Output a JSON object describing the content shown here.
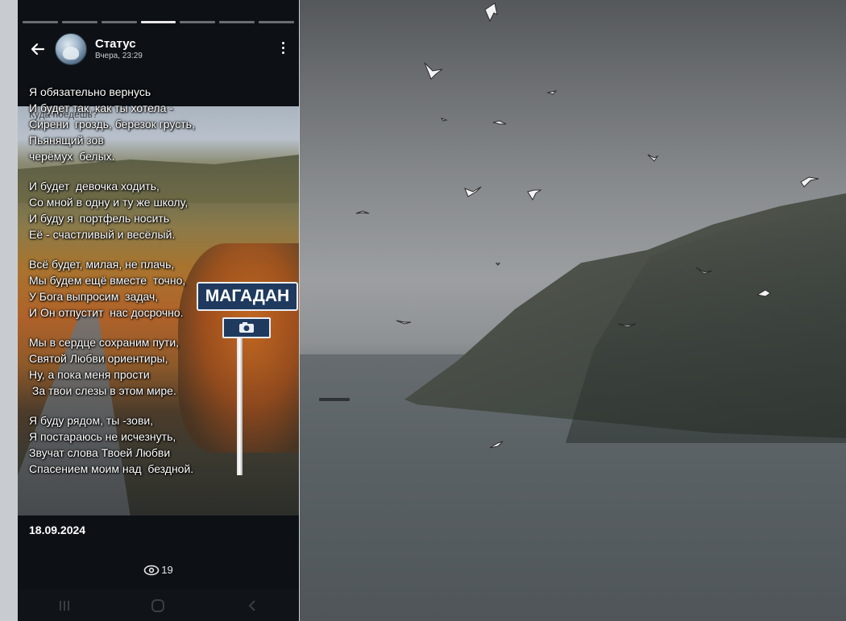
{
  "story": {
    "progress_segments": 7,
    "active_segment": 4,
    "author_name": "Статус",
    "posted_time": "Вчера, 23:29",
    "ghost_text": [
      "Куда поедешь?",
      "Я..."
    ],
    "sign_text": "МАГАДАН",
    "poem": [
      [
        "Я обязательно вернусь",
        "И будет так, как ты хотела -",
        "Сирени  гроздь, березок грусть,",
        "Пьянящий зов",
        "черёмух  белых."
      ],
      [
        "И будет  девочка ходить,",
        "Со мной в одну и ту же школу,",
        "И буду я  портфель носить",
        "Её - счастливый и весёлый."
      ],
      [
        "Всё будет, милая, не плачь,",
        "Мы будем ещё вместе  точно,",
        "У Бога выпросим  задач,",
        "И Он отпустит  нас досрочно."
      ],
      [
        "Мы в сердце сохраним пути,",
        "Святой Любви ориентиры,",
        "Ну, а пока меня прости",
        " За твои слезы в этом мире."
      ],
      [
        "Я буду рядом, ты -зови,",
        "Я постараюсь не исчезнуть,",
        "Звучат слова Твоей Любви",
        "Спасением моим над  бездной."
      ]
    ],
    "date": "18.09.2024",
    "views": "19",
    "icons": {
      "back": "arrow-left-icon",
      "menu": "more-vertical-icon",
      "views": "eye-icon",
      "nav_recent": "recent-apps-icon",
      "nav_home": "home-icon",
      "nav_back": "nav-back-icon"
    }
  },
  "colors": {
    "phone_bg": "#0d1116",
    "text": "#ffffff",
    "sign_blue": "#1f3a5e"
  }
}
